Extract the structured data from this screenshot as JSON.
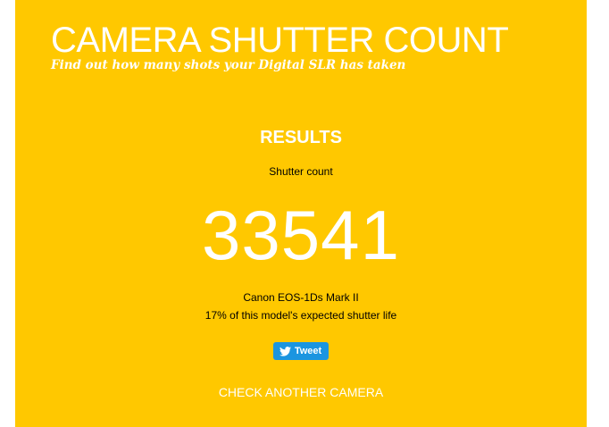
{
  "header": {
    "title": "CAMERA SHUTTER COUNT",
    "tagline": "Find out how many shots your Digital SLR has taken"
  },
  "results": {
    "heading": "RESULTS",
    "shutter_label": "Shutter count",
    "shutter_count": "33541",
    "camera_model": "Canon EOS-1Ds Mark II",
    "life_text": "17% of this model's expected shutter life"
  },
  "tweet": {
    "label": "Tweet",
    "icon": "twitter-bird-icon"
  },
  "actions": {
    "check_another": "CHECK ANOTHER CAMERA"
  },
  "colors": {
    "background": "#ffc800",
    "text": "#ffffff",
    "tweet_button": "#1b95e0"
  }
}
